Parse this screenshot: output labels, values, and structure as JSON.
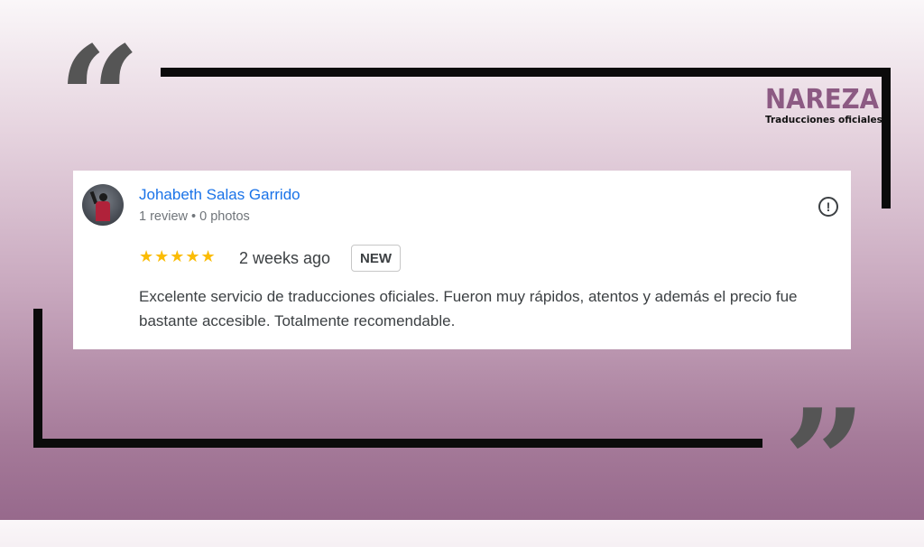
{
  "brand": {
    "name": "NAREZA",
    "tagline": "Traducciones oficiales"
  },
  "quotes": {
    "open": "“",
    "close": "”"
  },
  "review": {
    "reviewer_name": "Johabeth Salas Garrido",
    "reviewer_meta": "1 review • 0 photos",
    "rating": 5,
    "rating_stars": "★★★★★",
    "time_ago": "2 weeks ago",
    "badge": "NEW",
    "text": "Excelente servicio de traducciones oficiales. Fueron muy rápidos, atentos y además el precio fue bastante accesible. Totalmente recomendable.",
    "report_icon": "!"
  },
  "colors": {
    "reviewer_link": "#1a73e8",
    "star": "#fbbc04",
    "brand": "#8c5a83"
  }
}
